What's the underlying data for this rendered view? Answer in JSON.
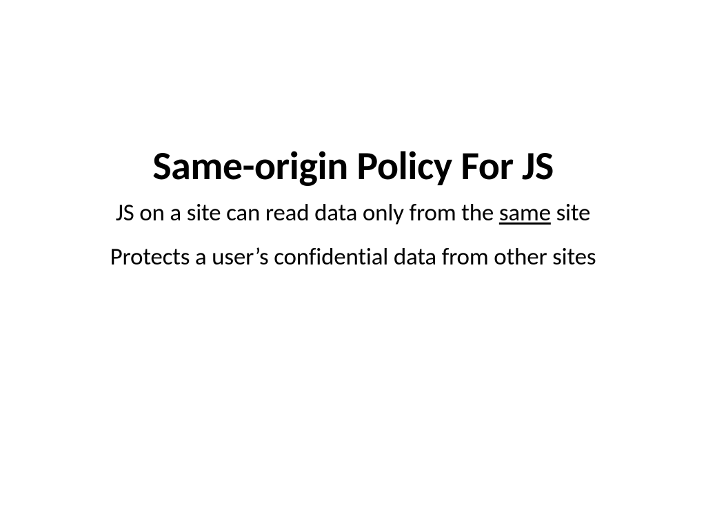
{
  "slide": {
    "title": "Same-origin Policy For JS",
    "subtitle_before": "JS on a site can read data only from the ",
    "subtitle_underlined": "same",
    "subtitle_after": " site",
    "body_line": "Protects a user’s confidential data from other sites"
  }
}
